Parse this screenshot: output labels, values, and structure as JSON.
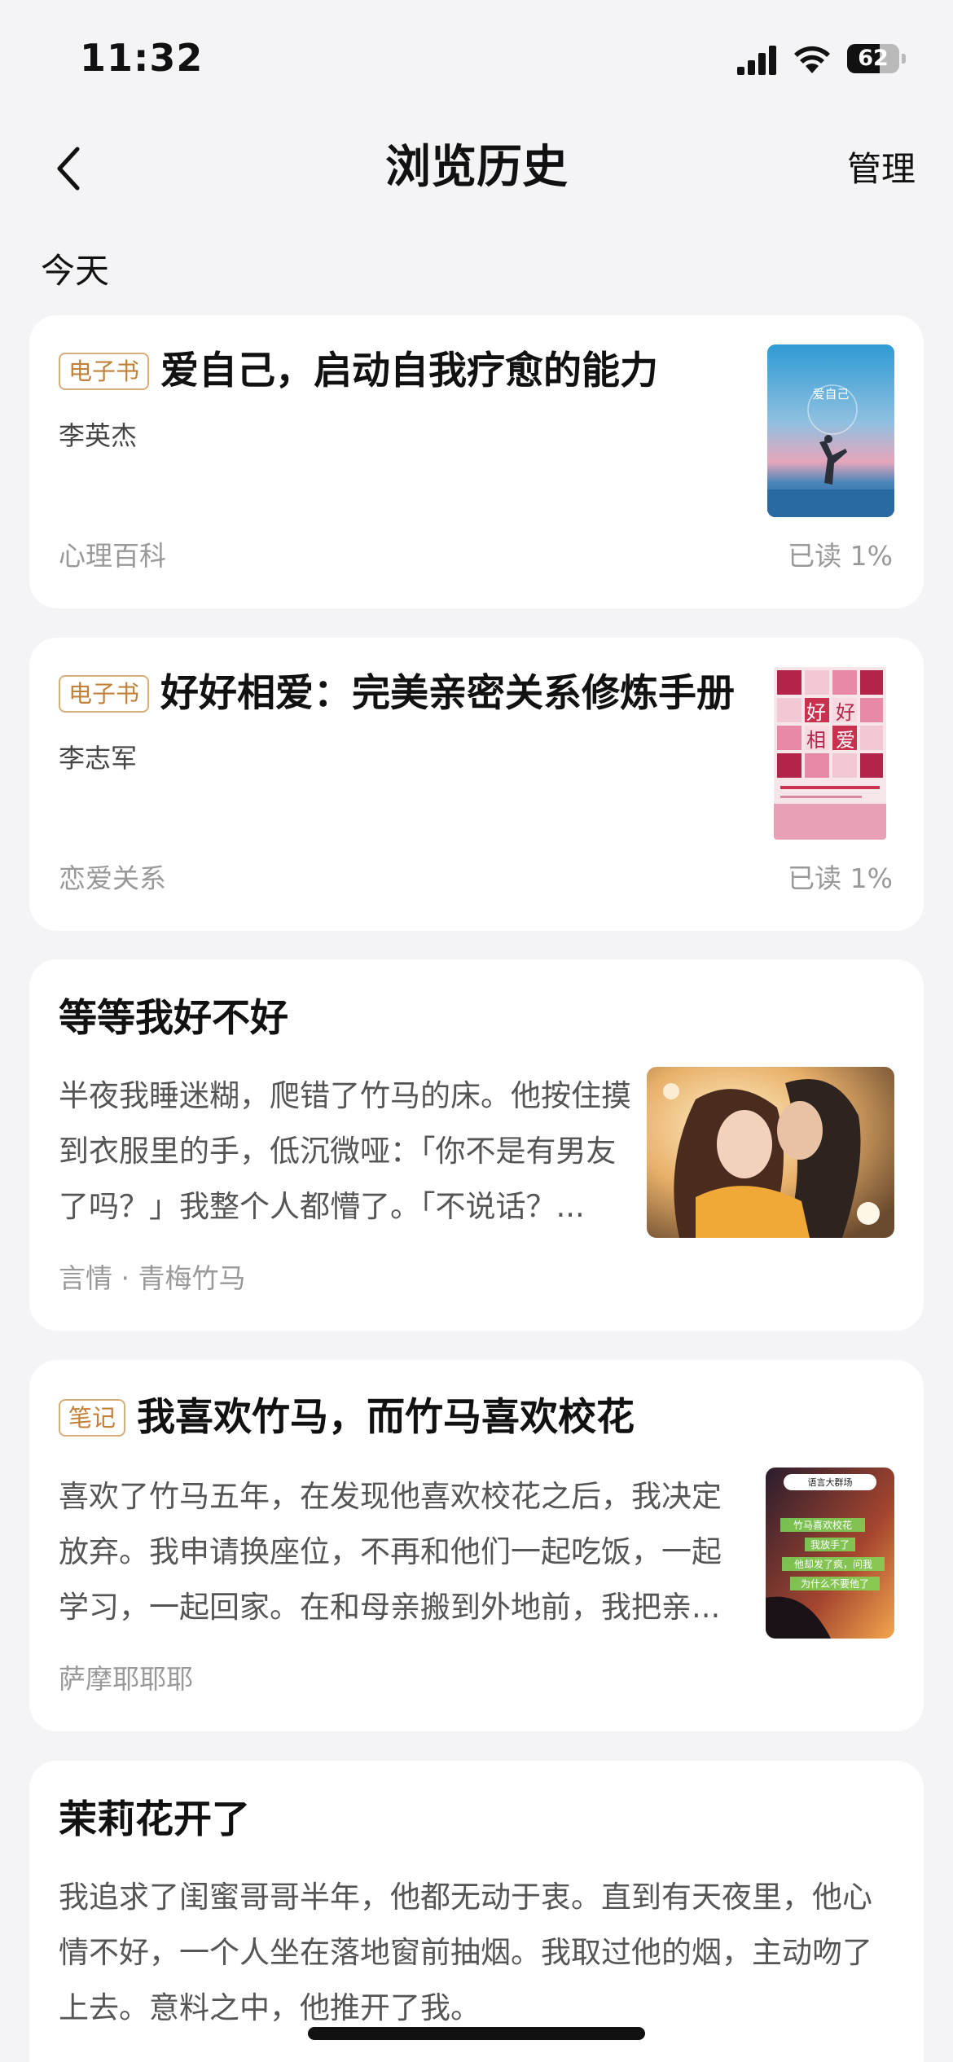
{
  "status_bar": {
    "time": "11:32",
    "battery_level": 62,
    "battery_text": "62"
  },
  "nav": {
    "title": "浏览历史",
    "manage_label": "管理"
  },
  "section": {
    "label": "今天"
  },
  "items": [
    {
      "tag": "电子书",
      "title": "爱自己，启动自我疗愈的能力",
      "author": "李英杰",
      "category": "心理百科",
      "progress": "已读 1%",
      "cover_text": "爱自己"
    },
    {
      "tag": "电子书",
      "title": "好好相爱：完美亲密关系修炼手册",
      "author": "李志军",
      "category": "恋爱关系",
      "progress": "已读 1%",
      "cover_chars": [
        "好",
        "好",
        "相",
        "爱"
      ]
    },
    {
      "title": "等等我好不好",
      "snippet": "半夜我睡迷糊，爬错了竹马的床。他按住摸到衣服里的手，低沉微哑：「你不是有男友了吗？」我整个人都懵了。「不说话？...",
      "category": "言情 · 青梅竹马"
    },
    {
      "tag": "笔记",
      "title": "我喜欢竹马，而竹马喜欢校花",
      "snippet": "喜欢了竹马五年，在发现他喜欢校花之后，我决定放弃。我申请换座位，不再和他们一起吃饭，一起学习，一起回家。在和母亲搬到外地前，我把亲...",
      "category": "萨摩耶耶耶",
      "cover_lines": [
        "语言大群场",
        "竹马喜欢校花",
        "我放手了",
        "他却发了疯，问我",
        "为什么不要他了"
      ]
    },
    {
      "title": "茉莉花开了",
      "snippet": "我追求了闺蜜哥哥半年，他都无动于衷。直到有天夜里，他心情不好，一个人坐在落地窗前抽烟。我取过他的烟，主动吻了上去。意料之中，他推开了我。"
    }
  ],
  "colors": {
    "tag_border": "#d7ad79",
    "tag_text": "#c2813a",
    "background": "#f4f4f6",
    "card": "#ffffff"
  }
}
